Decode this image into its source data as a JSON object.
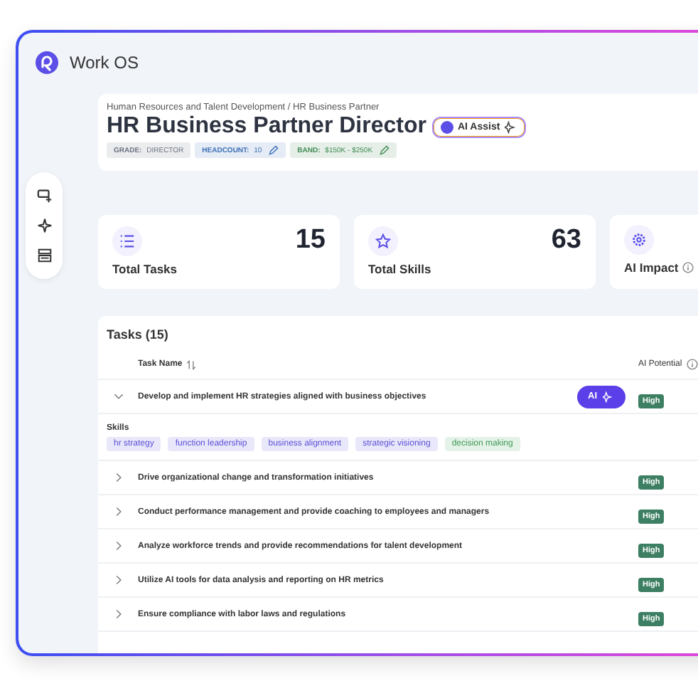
{
  "app": {
    "name": "Work OS"
  },
  "header": {
    "breadcrumb": "Human Resources and Talent Development / HR Business Partner",
    "title": "HR Business Partner Director",
    "ai_assist": "AI Assist",
    "badges": [
      {
        "label": "GRADE:",
        "value": "DIRECTOR",
        "color": "#6b7280",
        "editable": false
      },
      {
        "label": "HEADCOUNT:",
        "value": "10",
        "color": "#3b6fb6",
        "editable": true
      },
      {
        "label": "BAND:",
        "value": "$150K - $250K",
        "color": "#3f8a52",
        "editable": true
      }
    ]
  },
  "stats": [
    {
      "kind": "tasks",
      "value": "15",
      "label": "Total Tasks",
      "info": false
    },
    {
      "kind": "skills",
      "value": "63",
      "label": "Total Skills",
      "info": false
    },
    {
      "kind": "impact",
      "label": "AI Impact",
      "info": true
    }
  ],
  "tasks": {
    "title": "Tasks (15)",
    "columns": [
      {
        "label": "Task Name",
        "sortable": true
      },
      {
        "label": "AI Potential",
        "info": true
      }
    ],
    "rows": [
      {
        "name": "Develop and implement HR strategies aligned with business objectives",
        "expanded": true,
        "ai_button": "AI",
        "potential": "High",
        "skills_label": "Skills",
        "skills": [
          {
            "label": "hr strategy",
            "color": "#5b4fd8"
          },
          {
            "label": "function leadership",
            "color": "#5b4fd8"
          },
          {
            "label": "business alignment",
            "color": "#5b4fd8"
          },
          {
            "label": "strategic visioning",
            "color": "#5b4fd8"
          },
          {
            "label": "decision making",
            "color": "#3e9a55"
          }
        ]
      },
      {
        "name": "Drive organizational change and transformation initiatives",
        "expanded": false,
        "potential": "High"
      },
      {
        "name": "Conduct performance management and provide coaching to employees and managers",
        "expanded": false,
        "potential": "High"
      },
      {
        "name": "Analyze workforce trends and provide recommendations for talent development",
        "expanded": false,
        "potential": "High"
      },
      {
        "name": "Utilize AI tools for data analysis and reporting on HR metrics",
        "expanded": false,
        "potential": "High"
      },
      {
        "name": "Ensure compliance with labor laws and regulations",
        "expanded": false,
        "potential": "High"
      }
    ]
  }
}
